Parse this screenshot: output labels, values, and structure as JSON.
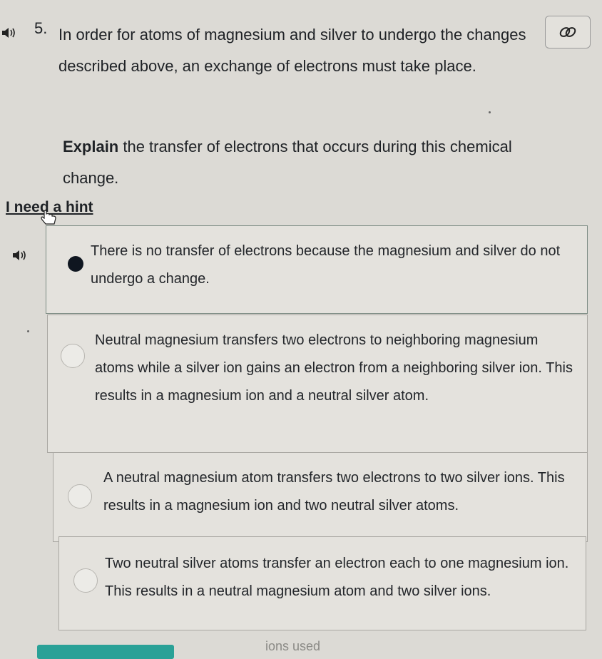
{
  "question": {
    "number": "5.",
    "text": "In order for atoms of magnesium and silver to undergo the changes described above, an exchange of electrons must take place.",
    "instruction_bold": "Explain",
    "instruction_rest": " the transfer of electrons that occurs during this chemical change."
  },
  "hint_link": "I need a hint",
  "options": [
    {
      "text": "There is no transfer of electrons because the magnesium and silver do not undergo a change.",
      "selected": true
    },
    {
      "text": "Neutral magnesium transfers two electrons to neighboring magnesium atoms while a silver ion gains an electron from a neighboring silver ion. This results in a magnesium ion and a neutral silver atom.",
      "selected": false
    },
    {
      "text": "A neutral magnesium atom transfers two electrons to two silver ions. This results in a magnesium ion and two neutral silver atoms.",
      "selected": false
    },
    {
      "text": "Two neutral silver atoms transfer an electron each to one magnesium ion. This results in a neutral magnesium atom and two silver ions.",
      "selected": false
    }
  ],
  "footer_text": "ions used",
  "icons": {
    "speaker": "speaker-icon",
    "link": "link-icon",
    "cursor": "hand-cursor-icon"
  },
  "colors": {
    "accent": "#2aa197",
    "selected_radio": "#0f1620"
  }
}
